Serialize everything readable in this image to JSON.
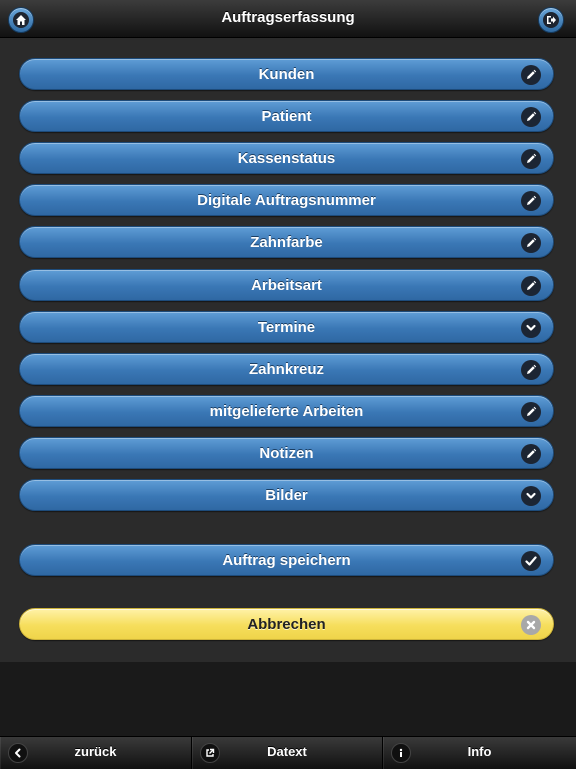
{
  "header": {
    "title": "Auftragserfassung",
    "left_icon": "home-icon",
    "right_icon": "logout-icon"
  },
  "menu": {
    "items": [
      {
        "label": "Kunden",
        "icon": "edit-icon"
      },
      {
        "label": "Patient",
        "icon": "edit-icon"
      },
      {
        "label": "Kassenstatus",
        "icon": "edit-icon"
      },
      {
        "label": "Digitale Auftragsnummer",
        "icon": "edit-icon"
      },
      {
        "label": "Zahnfarbe",
        "icon": "edit-icon"
      },
      {
        "label": "Arbeitsart",
        "icon": "edit-icon"
      },
      {
        "label": "Termine",
        "icon": "chevron-down-icon"
      },
      {
        "label": "Zahnkreuz",
        "icon": "edit-icon"
      },
      {
        "label": "mitgelieferte Arbeiten",
        "icon": "edit-icon"
      },
      {
        "label": "Notizen",
        "icon": "edit-icon"
      },
      {
        "label": "Bilder",
        "icon": "chevron-down-icon"
      }
    ]
  },
  "actions": {
    "save_label": "Auftrag speichern",
    "save_icon": "check-icon",
    "cancel_label": "Abbrechen",
    "cancel_icon": "close-icon"
  },
  "footer": {
    "tabs": [
      {
        "label": "zurück",
        "icon": "arrow-left-icon"
      },
      {
        "label": "Datext",
        "icon": "external-link-icon"
      },
      {
        "label": "Info",
        "icon": "info-icon"
      }
    ]
  },
  "colors": {
    "button_blue": "#3a77b5",
    "button_yellow": "#f6de5c",
    "header_dark": "#222222",
    "content_bg": "#2b2b2b"
  }
}
